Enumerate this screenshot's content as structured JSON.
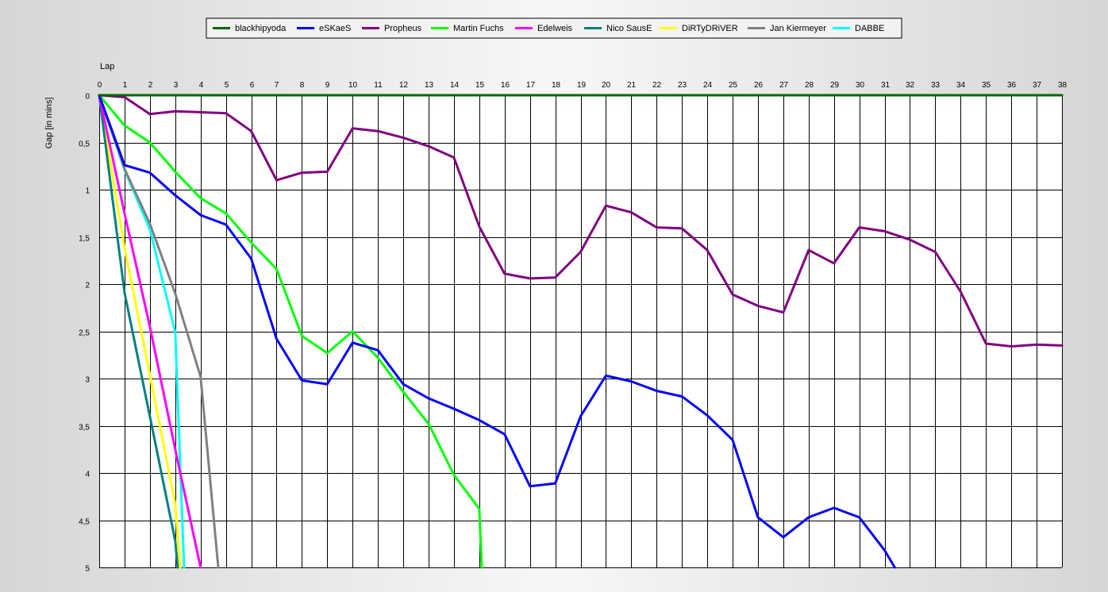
{
  "chart_data": {
    "type": "line",
    "xlabel": "Lap",
    "ylabel": "Gap [in mins]",
    "xlim": [
      0,
      38
    ],
    "ylim": [
      0,
      5
    ],
    "y_inverted": true,
    "x_ticks": [
      "0",
      "1",
      "2",
      "3",
      "4",
      "5",
      "6",
      "7",
      "8",
      "9",
      "10",
      "11",
      "12",
      "13",
      "14",
      "15",
      "16",
      "17",
      "18",
      "19",
      "20",
      "21",
      "22",
      "23",
      "24",
      "25",
      "26",
      "27",
      "28",
      "29",
      "30",
      "31",
      "32",
      "33",
      "34",
      "35",
      "36",
      "37",
      "38"
    ],
    "y_ticks": [
      "0",
      "0.5",
      "1",
      "1.5",
      "2",
      "2.5",
      "3",
      "3.5",
      "4",
      "4.5",
      "5"
    ],
    "grid": true,
    "legend_position": "top-center",
    "series": [
      {
        "name": "blackhipyoda",
        "color": "#006400",
        "x": [
          0,
          38
        ],
        "y": [
          0,
          0
        ]
      },
      {
        "name": "eSKaeS",
        "color": "#0000ff",
        "x": [
          0,
          1,
          2,
          3,
          4,
          5,
          6,
          7,
          8,
          9,
          10,
          11,
          12,
          13,
          14,
          15,
          16,
          17,
          18,
          19,
          20,
          21,
          22,
          23,
          24,
          25,
          26,
          27,
          28,
          29,
          30,
          31,
          31.4
        ],
        "y": [
          0,
          0.74,
          0.82,
          1.06,
          1.27,
          1.37,
          1.73,
          2.58,
          3.02,
          3.06,
          2.62,
          2.7,
          3.06,
          3.21,
          3.32,
          3.44,
          3.59,
          4.14,
          4.11,
          3.4,
          2.97,
          3.03,
          3.13,
          3.19,
          3.39,
          3.65,
          4.47,
          4.68,
          4.47,
          4.37,
          4.47,
          4.82,
          5.0
        ]
      },
      {
        "name": "Propheus",
        "color": "#800080",
        "x": [
          0,
          1,
          2,
          3,
          4,
          5,
          6,
          7,
          8,
          9,
          10,
          11,
          12,
          13,
          14,
          15,
          16,
          17,
          18,
          19,
          20,
          21,
          22,
          23,
          24,
          25,
          26,
          27,
          28,
          29,
          30,
          31,
          32,
          33,
          34,
          35,
          36,
          37,
          38
        ],
        "y": [
          0,
          0.02,
          0.2,
          0.17,
          0.18,
          0.19,
          0.38,
          0.9,
          0.82,
          0.81,
          0.35,
          0.38,
          0.45,
          0.54,
          0.66,
          1.39,
          1.89,
          1.94,
          1.93,
          1.66,
          1.17,
          1.24,
          1.4,
          1.41,
          1.64,
          2.11,
          2.23,
          2.3,
          1.64,
          1.78,
          1.4,
          1.44,
          1.53,
          1.66,
          2.08,
          2.63,
          2.66,
          2.64,
          2.65
        ]
      },
      {
        "name": "Martin Fuchs",
        "color": "#00ff00",
        "x": [
          0,
          1,
          2,
          3,
          4,
          5,
          6,
          7,
          8,
          9,
          10,
          11,
          12,
          13,
          14,
          15,
          15.1
        ],
        "y": [
          0,
          0.32,
          0.5,
          0.81,
          1.09,
          1.25,
          1.56,
          1.84,
          2.55,
          2.73,
          2.5,
          2.78,
          3.14,
          3.48,
          4.02,
          4.38,
          5.0
        ]
      },
      {
        "name": "Edelweis",
        "color": "#ff00ff",
        "x": [
          0,
          1,
          2,
          3,
          4
        ],
        "y": [
          0,
          1.25,
          2.45,
          3.75,
          5.0
        ]
      },
      {
        "name": "Nico SausE",
        "color": "#008080",
        "x": [
          0,
          1,
          2,
          3,
          3.1
        ],
        "y": [
          0,
          2.09,
          3.4,
          4.72,
          5.0
        ]
      },
      {
        "name": "DiRTyDRiVER",
        "color": "#ffff00",
        "x": [
          0,
          1,
          2,
          3,
          3.2
        ],
        "y": [
          0,
          1.62,
          2.96,
          4.33,
          5.0
        ]
      },
      {
        "name": "Jan Kiermeyer",
        "color": "#808080",
        "x": [
          0,
          1,
          2,
          3,
          4,
          4.7
        ],
        "y": [
          0,
          0.78,
          1.36,
          2.1,
          2.98,
          5.0
        ]
      },
      {
        "name": "DABBE",
        "color": "#00ffff",
        "x": [
          0,
          1,
          2,
          3,
          3.35
        ],
        "y": [
          0,
          0.79,
          1.42,
          2.51,
          5.0
        ]
      }
    ]
  }
}
